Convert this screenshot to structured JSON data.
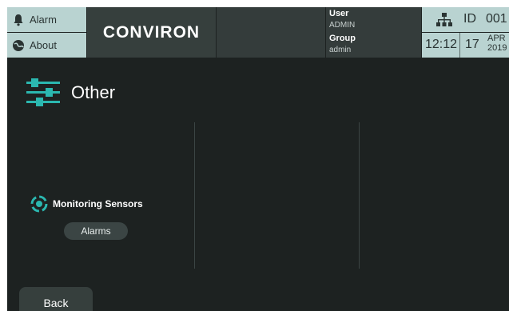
{
  "header": {
    "alarm_label": "Alarm",
    "about_label": "About",
    "logo_text": "CONVIRON",
    "user_label": "User",
    "user_value": "ADMIN",
    "group_label": "Group",
    "group_value": "admin",
    "id_label": "ID",
    "id_value": "001",
    "time": "12:12",
    "date_day": "17",
    "date_month": "APR",
    "date_year": "2019"
  },
  "page": {
    "title": "Other"
  },
  "sections": {
    "monitoring_label": "Monitoring Sensors",
    "alarms_button": "Alarms"
  },
  "footer": {
    "back_label": "Back"
  },
  "colors": {
    "background": "#1d2221",
    "panel": "#363f3d",
    "button_light": "#b9d3d1",
    "accent": "#2bb8b0"
  }
}
